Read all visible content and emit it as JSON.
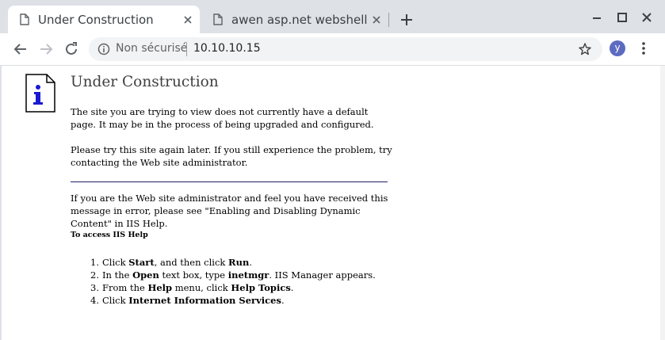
{
  "tabs": [
    {
      "title": "Under Construction",
      "active": true
    },
    {
      "title": "awen asp.net webshell",
      "active": false
    }
  ],
  "toolbar": {
    "security_label": "Non sécurisé",
    "url": "10.10.10.15",
    "avatar_letter": "y"
  },
  "page": {
    "title": "Under Construction",
    "para1": "The site you are trying to view does not currently have a default page. It may be in the process of being upgraded and configured.",
    "para2": "Please try this site again later. If you still experience the problem, try contacting the Web site administrator.",
    "para3": "If you are the Web site administrator and feel you have received this message in error, please see \"Enabling and Disabling Dynamic Content\" in IIS Help.",
    "help_heading": "To access IIS Help",
    "steps": [
      {
        "num": "1.",
        "a": "Click ",
        "b": "Start",
        "c": ", and then click ",
        "d": "Run",
        "e": "."
      },
      {
        "num": "2.",
        "a": "In the ",
        "b": "Open",
        "c": " text box, type ",
        "d": "inetmgr",
        "e": ". IIS Manager appears."
      },
      {
        "num": "3.",
        "a": "From the ",
        "b": "Help",
        "c": " menu, click ",
        "d": "Help Topics",
        "e": "."
      },
      {
        "num": "4.",
        "a": "Click ",
        "b": "Internet Information Services",
        "c": ".",
        "d": "",
        "e": ""
      }
    ]
  },
  "colors": {
    "tabstrip": "#dee1e6",
    "avatar": "#5c6bc0",
    "divider": "#1f1f6f"
  },
  "icons": [
    "page-icon",
    "close-icon",
    "plus-icon",
    "minimize-icon",
    "maximize-icon",
    "back-icon",
    "forward-icon",
    "reload-icon",
    "info-icon",
    "star-icon",
    "more-vert-icon"
  ]
}
